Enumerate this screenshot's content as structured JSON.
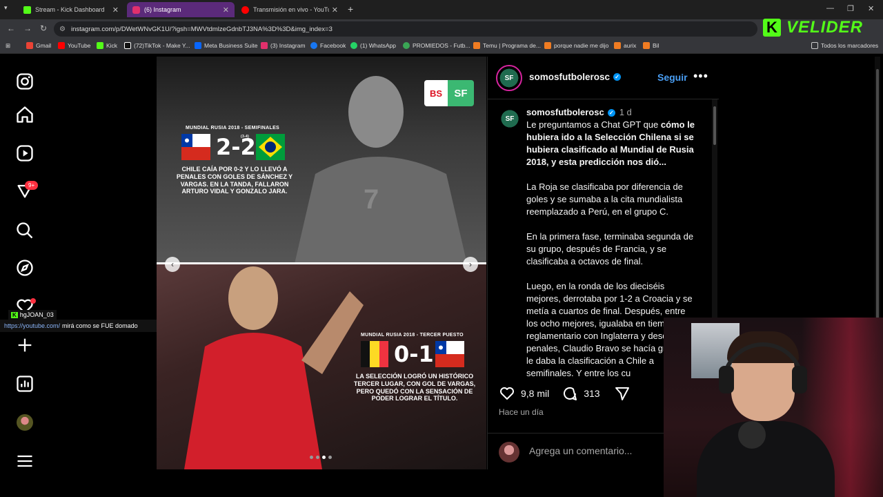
{
  "browser": {
    "tabs": [
      {
        "label": "Stream - Kick Dashboard",
        "color": "#53fc18"
      },
      {
        "label": "(6) Instagram",
        "color": "#e1306c"
      },
      {
        "label": "Transmisión en vivo - YouTube",
        "color": "#ff0000"
      }
    ],
    "url": "instagram.com/p/DWetWNvGK1U/?igsh=MWVtdmlzeGdnbTJ3NA%3D%3D&img_index=3",
    "bookmarks": [
      {
        "label": "Gmail",
        "color": "#ea4335"
      },
      {
        "label": "YouTube",
        "color": "#ff0000"
      },
      {
        "label": "Kick",
        "color": "#53fc18"
      },
      {
        "label": "(72)TikTok - Make Y...",
        "color": "#ffffff"
      },
      {
        "label": "Meta Business Suite",
        "color": "#0866ff"
      },
      {
        "label": "(3) Instagram",
        "color": "#e1306c"
      },
      {
        "label": "Facebook",
        "color": "#1877f2"
      },
      {
        "label": "(1) WhatsApp",
        "color": "#25d366"
      },
      {
        "label": "PROMIEDOS - Futb...",
        "color": "#3aa655"
      },
      {
        "label": "Temu | Programa de...",
        "color": "#f07c22"
      },
      {
        "label": "porque nadie me dijo",
        "color": "#f07c22"
      },
      {
        "label": "aurix",
        "color": "#f07c22"
      },
      {
        "label": "Bil",
        "color": "#f07c22"
      }
    ],
    "bookmarks_all": "Todos los marcadores"
  },
  "kick_watermark": {
    "letter": "K",
    "name": "VELIDER"
  },
  "sidebar": {
    "notif_badge": "9+"
  },
  "chat": {
    "user": "hgJOAN_03",
    "link": "https://youtube.com/",
    "message": "mirá como se FUE domado"
  },
  "post_image": {
    "logo_left": "BS",
    "logo_right": "SF",
    "top": {
      "title": "MUNDIAL RUSIA 2018 - SEMIFINALES",
      "score": "2-2",
      "penalties": "(3-4)",
      "caption": "CHILE CAÍA POR 0-2 Y LO LLEVÓ A PENALES CON GOLES DE SÁNCHEZ Y VARGAS. EN LA TANDA, FALLARON ARTURO VIDAL Y GONZALO JARA.",
      "jersey_number": "7"
    },
    "bottom": {
      "title": "MUNDIAL RUSIA 2018 - TERCER PUESTO",
      "score": "0-1",
      "caption": "LA SELECCIÓN LOGRÓ UN HISTÓRICO TERCER LUGAR, CON GOL DE VARGAS, PERO QUEDÓ CON LA SENSACIÓN DE PODER LOGRAR EL TÍTULO."
    },
    "carousel": {
      "count": 4,
      "active": 3
    }
  },
  "post": {
    "username": "somosfutbolerosc",
    "follow_label": "Seguir",
    "time": "1 d",
    "caption_bold": "cómo le hubiera ido a la Selección Chilena si se hubiera clasificado al Mundial de Rusia 2018, y esta predicción nos dió...",
    "caption_intro": "Le preguntamos a Chat GPT que ",
    "paragraphs": [
      "La Roja se clasificaba por diferencia de goles y se sumaba a la cita mundialista reemplazado a Perú, en el grupo C.",
      "En la primera fase, terminaba segunda de su grupo, después de Francia, y se clasificaba a octavos de final.",
      "Luego, en la ronda de los dieciséis mejores, derrotaba por 1-2 a Croacia y se metía a cuartos de final. Después, entre los ocho mejores, igualaba en tiempo reglamentario con Inglaterra y desde los penales, Claudio Bravo se hacía grande y le daba la clasificación a Chile a semifinales. Y entre los cu"
    ],
    "likes": "9,8 mil",
    "comments": "313",
    "time_footer": "Hace un día",
    "comment_placeholder": "Agrega un comentario..."
  }
}
